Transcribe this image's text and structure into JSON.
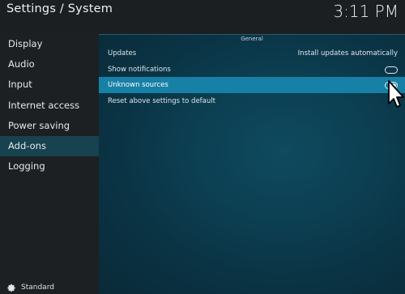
{
  "header": {
    "title": "Settings / System",
    "clock": "3:11 PM"
  },
  "sidebar": {
    "items": [
      {
        "label": "Display"
      },
      {
        "label": "Audio"
      },
      {
        "label": "Input"
      },
      {
        "label": "Internet access"
      },
      {
        "label": "Power saving"
      },
      {
        "label": "Add-ons"
      },
      {
        "label": "Logging"
      }
    ],
    "active_item": "Add-ons",
    "footer": {
      "label": "Standard",
      "icon": "gear-icon"
    }
  },
  "main": {
    "section_title": "General",
    "settings": [
      {
        "label": "Updates",
        "value": "Install updates automatically"
      },
      {
        "label": "Show notifications",
        "toggle": "off"
      },
      {
        "label": "Unknown sources",
        "toggle": "on"
      },
      {
        "label": "Reset above settings to default"
      }
    ]
  },
  "colors": {
    "accent": "#1780a6",
    "sidebar_active": "#17424f",
    "background": "#1b1f21"
  }
}
